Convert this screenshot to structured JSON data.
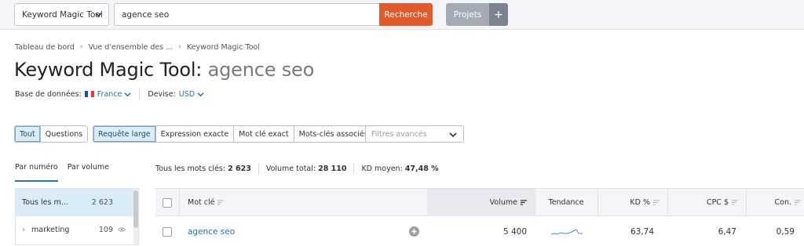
{
  "topbar": {
    "tool_select": "Keyword Magic Tool",
    "search_value": "agence seo",
    "search_button": "Recherche",
    "projects_button": "Projets",
    "projects_plus": "+"
  },
  "breadcrumb": [
    "Tableau de bord",
    "Vue d'ensemble des ...",
    "Keyword Magic Tool"
  ],
  "title": {
    "prefix": "Keyword Magic Tool:",
    "query": "agence seo"
  },
  "meta": {
    "database_label": "Base de données:",
    "database_value": "France",
    "currency_label": "Devise:",
    "currency_value": "USD"
  },
  "filters": {
    "match_types": [
      "Tout",
      "Questions"
    ],
    "query_types": [
      "Requête large",
      "Expression exacte",
      "Mot clé exact",
      "Mots-clés associés"
    ],
    "advanced_placeholder": "Filtres avancés"
  },
  "sort_tabs": [
    "Par numéro",
    "Par volume"
  ],
  "stats": {
    "all_label": "Tous les mots clés:",
    "all_value": "2 623",
    "volume_label": "Volume total:",
    "volume_value": "28 110",
    "kd_label": "KD moyen:",
    "kd_value": "47,48 %"
  },
  "groups": [
    {
      "label": "Tous les m...",
      "count": "2 623"
    },
    {
      "label": "marketing",
      "count": "109"
    }
  ],
  "table": {
    "headers": {
      "keyword": "Mot clé",
      "volume": "Volume",
      "trend": "Tendance",
      "kd": "KD %",
      "cpc": "CPC $",
      "com": "Con."
    },
    "rows": [
      {
        "keyword": "agence seo",
        "volume": "5 400",
        "kd": "63,74",
        "cpc": "6,47",
        "com": "0,59"
      }
    ]
  },
  "colors": {
    "accent_orange": "#e05a2b",
    "link_blue": "#2a6fb0",
    "active_bg": "#d9ecf8"
  }
}
